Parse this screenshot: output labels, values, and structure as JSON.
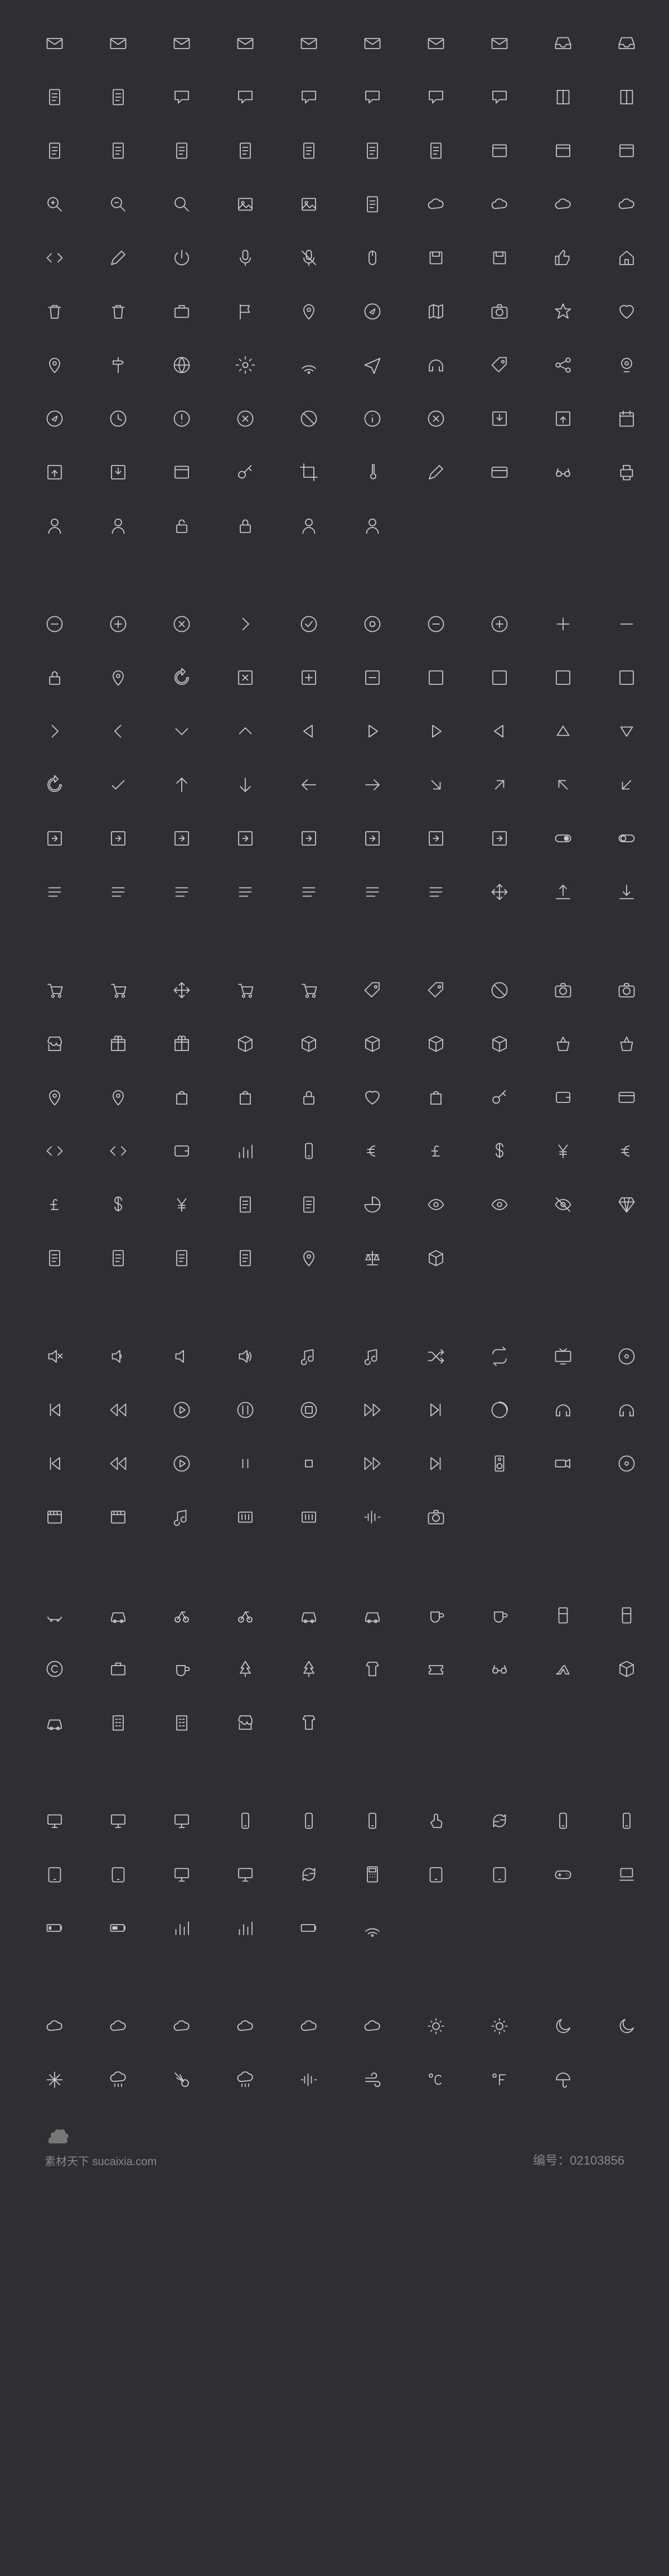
{
  "footer": {
    "domain": "素材天下 sucaixia.com",
    "id_label": "编号：02103856"
  },
  "icon_sections": [
    {
      "name": "communication-docs",
      "rows": [
        [
          "mail-icon",
          "mail-open-icon",
          "mail-forward-icon",
          "mail-reply-icon",
          "mail-attach-icon",
          "mail-block-icon",
          "mail-stack-icon",
          "mail-download-icon",
          "inbox-fill-icon",
          "inbox-icon"
        ],
        [
          "document-icon",
          "documents-icon",
          "chat-icon",
          "chat-ellipsis-icon",
          "chat-reply-icon",
          "chat-bubble-icon",
          "chat-lines-icon",
          "speech-icon",
          "book-icon",
          "notebook-icon"
        ],
        [
          "page-lines-icon",
          "page-text-icon",
          "page-grid-icon",
          "page-blank-icon",
          "page-dual-icon",
          "page-lines-alt-icon",
          "page-small-icon",
          "window-icon",
          "window-stack-icon",
          "window-tab-icon"
        ],
        [
          "zoom-in-icon",
          "zoom-out-icon",
          "search-icon",
          "image-icon",
          "image-multi-icon",
          "clipboard-icon",
          "cloud-download-icon",
          "cloud-upload-icon",
          "cloud-check-icon",
          "cloud-icon"
        ],
        [
          "code-icon",
          "pencil-icon",
          "power-icon",
          "microphone-icon",
          "microphone-off-icon",
          "mouse-icon",
          "save-icon",
          "drive-icon",
          "thumbs-up-icon",
          "home-icon"
        ],
        [
          "trash-icon",
          "trash-open-icon",
          "briefcase-icon",
          "flag-icon",
          "location-pin-icon",
          "compass-circle-icon",
          "map-icon",
          "camera-round-icon",
          "star-icon",
          "heart-icon"
        ],
        [
          "user-pin-icon",
          "signpost-icon",
          "globe-icon",
          "settings-gear-icon",
          "wifi-rss-icon",
          "send-plane-icon",
          "headphones-mic-icon",
          "tag-icon",
          "share-nodes-icon",
          "webcam-icon"
        ],
        [
          "compass-icon",
          "clock-icon",
          "alert-circle-icon",
          "error-circle-icon",
          "ban-icon",
          "info-circle-icon",
          "error-404-icon",
          "download-box-icon",
          "upload-box-icon",
          "calendar-icon"
        ],
        [
          "export-icon",
          "import-box-icon",
          "window-popup-icon",
          "key-icon",
          "crop-corner-icon",
          "thermometer-icon",
          "pen-icon",
          "credit-card-icon",
          "glasses-icon",
          "printer-icon"
        ],
        [
          "user-icon",
          "user-add-icon",
          "unlock-icon",
          "lock-icon",
          "user-circle-icon",
          "user-circle-alt-icon"
        ]
      ]
    },
    {
      "name": "arrows-ui",
      "rows": [
        [
          "minus-circle-icon",
          "plus-circle-icon",
          "x-circle-icon",
          "chevron-right-circle-icon",
          "check-circle-icon",
          "record-circle-icon",
          "minus-circle-thin-icon",
          "plus-circle-thin-icon",
          "plus-icon",
          "minus-icon"
        ],
        [
          "refresh-lock-icon",
          "spinner-icon",
          "refresh-icon",
          "x-square-icon",
          "plus-square-icon",
          "minus-square-icon",
          "chevron-up-square-icon",
          "chevron-down-square-icon",
          "chevron-right-square-icon",
          "chevron-left-square-icon"
        ],
        [
          "chevron-right-icon",
          "chevron-left-icon",
          "chevron-down-icon",
          "chevron-up-icon",
          "caret-left-icon",
          "caret-right-icon",
          "play-triangle-icon",
          "play-triangle-left-icon",
          "triangle-up-icon",
          "triangle-down-icon"
        ],
        [
          "refresh-arrows-icon",
          "check-icon",
          "arrow-up-icon",
          "arrow-down-icon",
          "arrow-left-icon",
          "arrow-right-icon",
          "arrow-down-right-icon",
          "arrow-up-right-icon",
          "arrow-up-left-icon",
          "arrow-down-left-icon"
        ],
        [
          "arrow-box-up-left-icon",
          "arrow-box-up-icon",
          "arrow-box-up-right-icon",
          "arrow-box-right-icon",
          "arrow-box-down-right-icon",
          "arrow-box-down-icon",
          "arrow-box-down-left-icon",
          "arrow-box-left-icon",
          "toggle-on-icon",
          "toggle-off-icon"
        ],
        [
          "list-bullets-icon",
          "align-justify-icon",
          "align-left-icon",
          "align-center-icon",
          "align-right-icon",
          "list-numbered-icon",
          "list-icon",
          "move-arrows-icon",
          "upload-icon",
          "download-icon"
        ]
      ]
    },
    {
      "name": "commerce",
      "rows": [
        [
          "cart-icon",
          "cart-add-icon",
          "cart-remove-icon",
          "cart-check-icon",
          "cart-x-icon",
          "tag-flat-icon",
          "tags-icon",
          "bank-note-icon",
          "camera-front-icon",
          "camera-flip-icon"
        ],
        [
          "store-icon",
          "gift-icon",
          "gift-open-icon",
          "package-icon",
          "package-open-icon",
          "box-cube-icon",
          "box-open-icon",
          "crate-icon",
          "basket-icon",
          "basket-full-icon"
        ],
        [
          "shopping-bag-icon",
          "shopping-bag-lines-icon",
          "bag-minus-icon",
          "bag-plus-icon",
          "bag-lock-icon",
          "bag-heart-icon",
          "handbag-icon",
          "keyboard-icon",
          "wallet-icon",
          "card-outline-icon"
        ],
        [
          "barcode-icon",
          "barcode-scan-icon",
          "wallet-open-icon",
          "bar-chart-icon",
          "smartphone-pay-icon",
          "euro-icon",
          "pound-icon",
          "dollar-icon",
          "yen-icon",
          "euro-circle-icon"
        ],
        [
          "pound-circle-icon",
          "dollar-circle-icon",
          "yen-circle-icon",
          "receipt-lines-icon",
          "receipt-short-icon",
          "pie-chart-icon",
          "eye-icon",
          "eye-open-icon",
          "eye-off-icon",
          "diamond-icon"
        ],
        [
          "receipt-star-icon",
          "receipt-pound-icon",
          "receipt-yen-icon",
          "receipt-euro-icon",
          "chart-pin-icon",
          "scale-icon",
          "dollar-box-icon"
        ]
      ]
    },
    {
      "name": "media",
      "rows": [
        [
          "volume-off-icon",
          "volume-low-icon",
          "volume-icon",
          "volume-high-icon",
          "music-note-icon",
          "music-notes-icon",
          "shuffle-icon",
          "repeat-icon",
          "tv-icon",
          "disc-play-icon"
        ],
        [
          "skip-first-icon",
          "rewind-circle-icon",
          "play-circle-icon",
          "pause-circle-icon",
          "stop-circle-icon",
          "forward-circle-icon",
          "skip-last-icon",
          "loading-circle-icon",
          "headphones-icon",
          "headset-icon"
        ],
        [
          "skip-back-icon",
          "rewind-icon",
          "play-outline-icon",
          "pause-icon",
          "stop-icon",
          "fast-forward-icon",
          "skip-forward-icon",
          "speaker-icon",
          "camcorder-icon",
          "film-reel-icon"
        ],
        [
          "film-strip-icon",
          "clapperboard-icon",
          "music-badge-icon",
          "mixer-icon",
          "radio-icon",
          "soundwave-icon",
          "camera-icon"
        ]
      ]
    },
    {
      "name": "lifestyle",
      "rows": [
        [
          "skateboard-icon",
          "car-icon",
          "scooter-icon",
          "bicycle-icon",
          "taxi-icon",
          "truck-icon",
          "coffee-cup-icon",
          "cocktail-icon",
          "kitchen-icon",
          "fridge-icon"
        ],
        [
          "copyright-icon",
          "suitcase-icon",
          "drink-cup-icon",
          "tree-icon",
          "plant-icon",
          "shorts-icon",
          "ticket-icon",
          "sunglasses-icon",
          "high-heel-icon",
          "hanger-box-icon"
        ],
        [
          "bus-icon",
          "building-icon",
          "buildings-icon",
          "shop-front-icon",
          "tshirt-icon"
        ]
      ]
    },
    {
      "name": "devices",
      "rows": [
        [
          "monitor-play-icon",
          "monitor-icon",
          "laptop-icon",
          "phone-landscape-icon",
          "phone-icon",
          "phone-vibrate-icon",
          "touch-icon",
          "device-sync-icon",
          "phone-front-icon",
          "phone-back-icon"
        ],
        [
          "tablet-icon",
          "tablet-horizontal-icon",
          "laptop-open-icon",
          "monitor-wide-icon",
          "device-rotate-icon",
          "calculator-icon",
          "tablet-draw-icon",
          "tablet-stylus-icon",
          "game-controller-icon",
          "device-dock-icon"
        ],
        [
          "battery-low-icon",
          "battery-half-icon",
          "signal-low-icon",
          "signal-full-icon",
          "battery-icon",
          "wifi-icon"
        ]
      ]
    },
    {
      "name": "weather",
      "rows": [
        [
          "cloud-rain-icon",
          "cloud-partly-icon",
          "cloud-snow-icon",
          "cloud-outline-icon",
          "cloud-lightning-icon",
          "cloud-heavy-rain-icon",
          "sun-small-icon",
          "sun-icon",
          "moon-circle-icon",
          "moon-crescent-icon"
        ],
        [
          "sparkles-icon",
          "snowflake-icon",
          "comet-icon",
          "rainbow-icon",
          "wave-icon",
          "wind-icon",
          "celsius-icon",
          "fahrenheit-icon",
          "umbrella-icon"
        ]
      ]
    }
  ]
}
